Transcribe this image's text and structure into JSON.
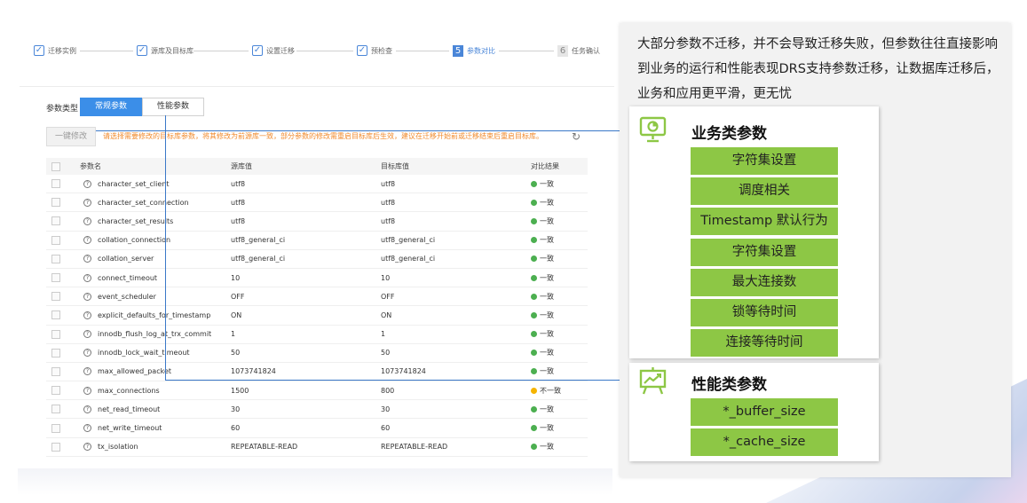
{
  "steps": [
    {
      "label": "迁移实例",
      "state": "done"
    },
    {
      "label": "源库及目标库",
      "state": "done"
    },
    {
      "label": "设置迁移",
      "state": "done"
    },
    {
      "label": "预检查",
      "state": "done"
    },
    {
      "label": "参数对比",
      "state": "active",
      "number": "5"
    },
    {
      "label": "任务确认",
      "state": "pending",
      "number": "6"
    }
  ],
  "param_type": {
    "label": "参数类型",
    "tabs": [
      "常规参数",
      "性能参数"
    ],
    "active_tab": "常规参数"
  },
  "toolbar": {
    "modify_button": "一键修改",
    "hint": "请选择需要修改的目标库参数，将其修改为前源库一致，部分参数的修改需重启目标库后生效，建议在迁移开始前或迁移结束后重启目标库。"
  },
  "table": {
    "headers": [
      "参数名",
      "源库值",
      "目标库值",
      "对比结果"
    ],
    "rows": [
      {
        "name": "character_set_client",
        "src": "utf8",
        "dst": "utf8",
        "result": "一致",
        "status": "ok"
      },
      {
        "name": "character_set_connection",
        "src": "utf8",
        "dst": "utf8",
        "result": "一致",
        "status": "ok"
      },
      {
        "name": "character_set_results",
        "src": "utf8",
        "dst": "utf8",
        "result": "一致",
        "status": "ok"
      },
      {
        "name": "collation_connection",
        "src": "utf8_general_ci",
        "dst": "utf8_general_ci",
        "result": "一致",
        "status": "ok"
      },
      {
        "name": "collation_server",
        "src": "utf8_general_ci",
        "dst": "utf8_general_ci",
        "result": "一致",
        "status": "ok"
      },
      {
        "name": "connect_timeout",
        "src": "10",
        "dst": "10",
        "result": "一致",
        "status": "ok"
      },
      {
        "name": "event_scheduler",
        "src": "OFF",
        "dst": "OFF",
        "result": "一致",
        "status": "ok"
      },
      {
        "name": "explicit_defaults_for_timestamp",
        "src": "ON",
        "dst": "ON",
        "result": "一致",
        "status": "ok"
      },
      {
        "name": "innodb_flush_log_at_trx_commit",
        "src": "1",
        "dst": "1",
        "result": "一致",
        "status": "ok"
      },
      {
        "name": "innodb_lock_wait_timeout",
        "src": "50",
        "dst": "50",
        "result": "一致",
        "status": "ok"
      },
      {
        "name": "max_allowed_packet",
        "src": "1073741824",
        "dst": "1073741824",
        "result": "一致",
        "status": "ok"
      },
      {
        "name": "max_connections",
        "src": "1500",
        "dst": "800",
        "result": "不一致",
        "status": "warn"
      },
      {
        "name": "net_read_timeout",
        "src": "30",
        "dst": "30",
        "result": "一致",
        "status": "ok"
      },
      {
        "name": "net_write_timeout",
        "src": "60",
        "dst": "60",
        "result": "一致",
        "status": "ok"
      },
      {
        "name": "tx_isolation",
        "src": "REPEATABLE-READ",
        "dst": "REPEATABLE-READ",
        "result": "一致",
        "status": "ok"
      }
    ]
  },
  "colors": {
    "ok": "#4caf50",
    "warn": "#f5b400",
    "accent": "#3b8ee8",
    "green_box": "#8dc745"
  },
  "panel": {
    "intro": "大部分参数不迁移，并不会导致迁移失败，但参数往往直接影响到业务的运行和性能表现DRS支持参数迁移，让数据库迁移后，业务和应用更平滑，更无忧",
    "business": {
      "title": "业务类参数",
      "icon": "presentation-chart-icon",
      "items": [
        "字符集设置",
        "调度相关",
        "Timestamp 默认行为",
        "字符集设置",
        "最大连接数",
        "锁等待时间",
        "连接等待时间"
      ]
    },
    "performance": {
      "title": "性能类参数",
      "icon": "trend-board-icon",
      "items": [
        "*_buffer_size",
        "*_cache_size"
      ]
    }
  }
}
